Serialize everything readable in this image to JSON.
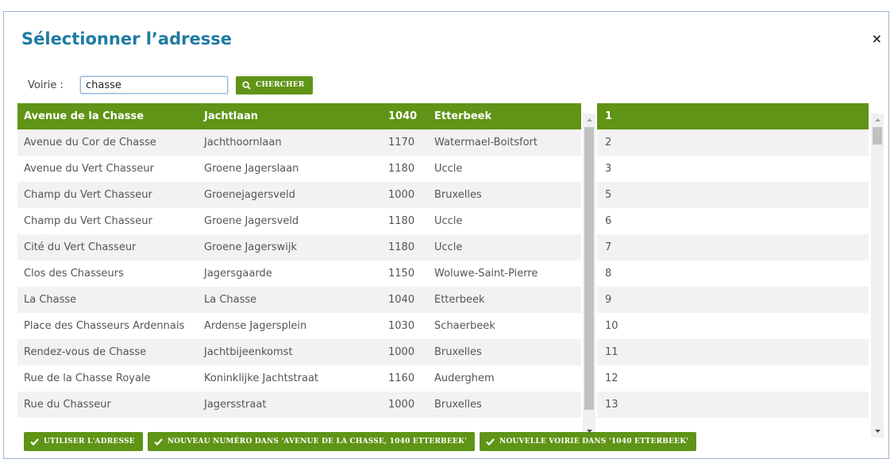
{
  "dialog": {
    "title": "Sélectionner l’adresse",
    "close_label": "×"
  },
  "search": {
    "label": "Voirie :",
    "value": "chasse",
    "button_label": "CHERCHER"
  },
  "streets": [
    {
      "name": "Avenue de la Chasse",
      "nl": "Jachtlaan",
      "cp": "1040",
      "city": "Etterbeek"
    },
    {
      "name": "Avenue du Cor de Chasse",
      "nl": "Jachthoornlaan",
      "cp": "1170",
      "city": "Watermael-Boitsfort"
    },
    {
      "name": "Avenue du Vert Chasseur",
      "nl": "Groene Jagerslaan",
      "cp": "1180",
      "city": "Uccle"
    },
    {
      "name": "Champ du Vert Chasseur",
      "nl": "Groenejagersveld",
      "cp": "1000",
      "city": "Bruxelles"
    },
    {
      "name": "Champ du Vert Chasseur",
      "nl": "Groene Jagersveld",
      "cp": "1180",
      "city": "Uccle"
    },
    {
      "name": "Cité du Vert Chasseur",
      "nl": "Groene Jagerswijk",
      "cp": "1180",
      "city": "Uccle"
    },
    {
      "name": "Clos des Chasseurs",
      "nl": "Jagersgaarde",
      "cp": "1150",
      "city": "Woluwe-Saint-Pierre"
    },
    {
      "name": "La Chasse",
      "nl": "La Chasse",
      "cp": "1040",
      "city": "Etterbeek"
    },
    {
      "name": "Place des Chasseurs Ardennais",
      "nl": "Ardense Jagersplein",
      "cp": "1030",
      "city": "Schaerbeek"
    },
    {
      "name": "Rendez-vous de Chasse",
      "nl": "Jachtbijeenkomst",
      "cp": "1000",
      "city": "Bruxelles"
    },
    {
      "name": "Rue de la Chasse Royale",
      "nl": "Koninklijke Jachtstraat",
      "cp": "1160",
      "city": "Auderghem"
    },
    {
      "name": "Rue du Chasseur",
      "nl": "Jagersstraat",
      "cp": "1000",
      "city": "Bruxelles"
    }
  ],
  "numbers": [
    "1",
    "2",
    "3",
    "5",
    "6",
    "7",
    "8",
    "9",
    "10",
    "11",
    "12",
    "13"
  ],
  "footer": {
    "use_address": "UTILISER L'ADRESSE",
    "new_number": "NOUVEAU NUMÉRO DANS 'AVENUE DE LA CHASSE, 1040 ETTERBEEK'",
    "new_street": "NOUVELLE VOIRIE DANS '1040 ETTERBEEK'"
  },
  "colors": {
    "accent": "#5f9416",
    "title": "#1e7ba3"
  }
}
